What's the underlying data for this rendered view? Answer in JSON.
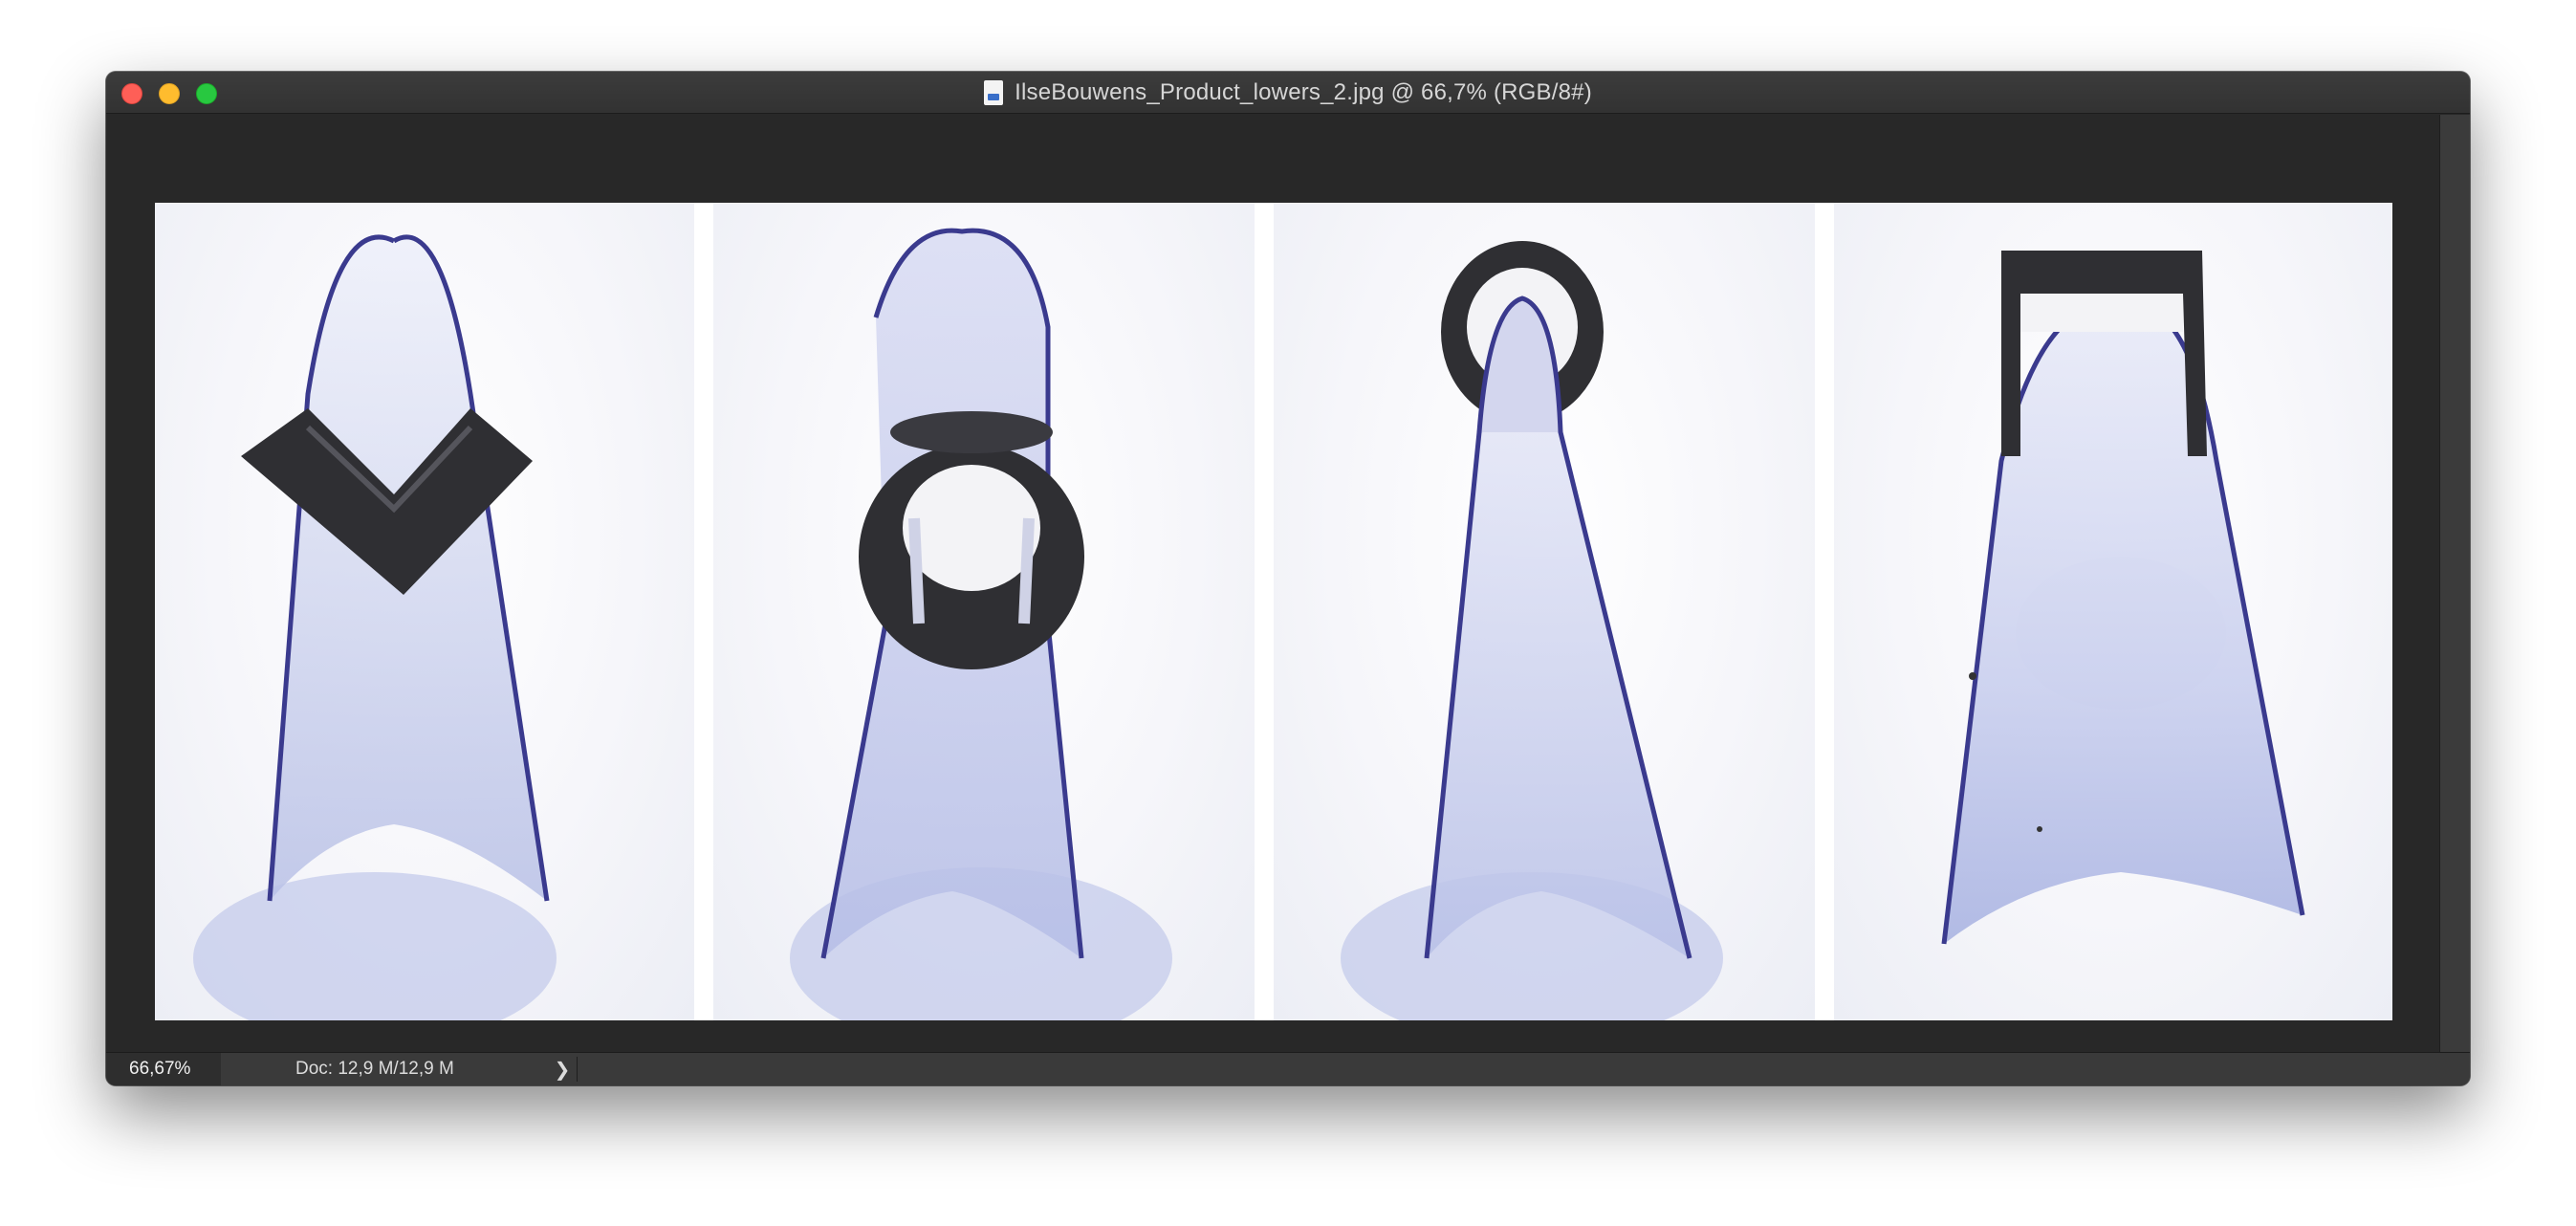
{
  "window": {
    "title": "IlseBouwens_Product_lowers_2.jpg @ 66,7% (RGB/8#)",
    "title_icon": "document-image-icon"
  },
  "statusbar": {
    "zoom": "66,67%",
    "doc_size": "Doc: 12,9 M/12,9 M",
    "arrow": "❯"
  },
  "image": {
    "panels": [
      {
        "name": "panel-v-profile",
        "collar_shape": "v-angle"
      },
      {
        "name": "panel-round-tube",
        "collar_shape": "round-tube-front"
      },
      {
        "name": "panel-ring",
        "collar_shape": "ring"
      },
      {
        "name": "panel-square-channel",
        "collar_shape": "square-channel"
      }
    ],
    "colors": {
      "sheet_edge": "#3a3a8e",
      "sheet_fill": "#d6d9ef",
      "shadow": "#a9b3e0",
      "metal": "#2f2f33"
    }
  }
}
